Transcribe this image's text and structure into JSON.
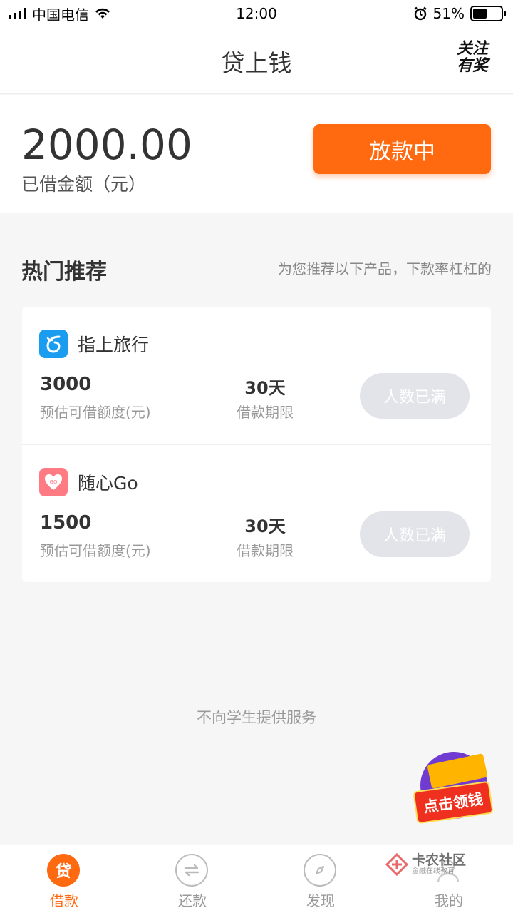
{
  "status_bar": {
    "carrier": "中国电信",
    "time": "12:00",
    "battery": "51%",
    "battery_level": 0.51
  },
  "nav": {
    "title": "贷上钱",
    "follow_badge_line1": "关注",
    "follow_badge_line2": "有奖"
  },
  "summary": {
    "amount": "2000.00",
    "amount_label": "已借金额（元）",
    "status_button": "放款中",
    "accent_color": "#ff6a10"
  },
  "hot": {
    "title": "热门推荐",
    "subtitle": "为您推荐以下产品，下款率杠杠的"
  },
  "products": [
    {
      "name": "指上旅行",
      "icon": "travel-app-icon",
      "amount": "3000",
      "amount_label": "预估可借额度(元)",
      "term": "30天",
      "term_label": "借款期限",
      "button": "人数已满"
    },
    {
      "name": "随心Go",
      "icon": "heart-tag-app-icon",
      "amount": "1500",
      "amount_label": "预估可借额度(元)",
      "term": "30天",
      "term_label": "借款期限",
      "button": "人数已满"
    }
  ],
  "disclaimer": "不向学生提供服务",
  "promo": {
    "label": "点击领钱"
  },
  "tabs": [
    {
      "label": "借款",
      "icon": "loan-icon",
      "icon_char": "贷",
      "active": true
    },
    {
      "label": "还款",
      "icon": "repay-icon",
      "active": false
    },
    {
      "label": "发现",
      "icon": "compass-icon",
      "active": false
    },
    {
      "label": "我的",
      "icon": "user-icon",
      "active": false
    }
  ],
  "watermark": {
    "main": "卡农社区",
    "sub": "金融在线教育"
  }
}
